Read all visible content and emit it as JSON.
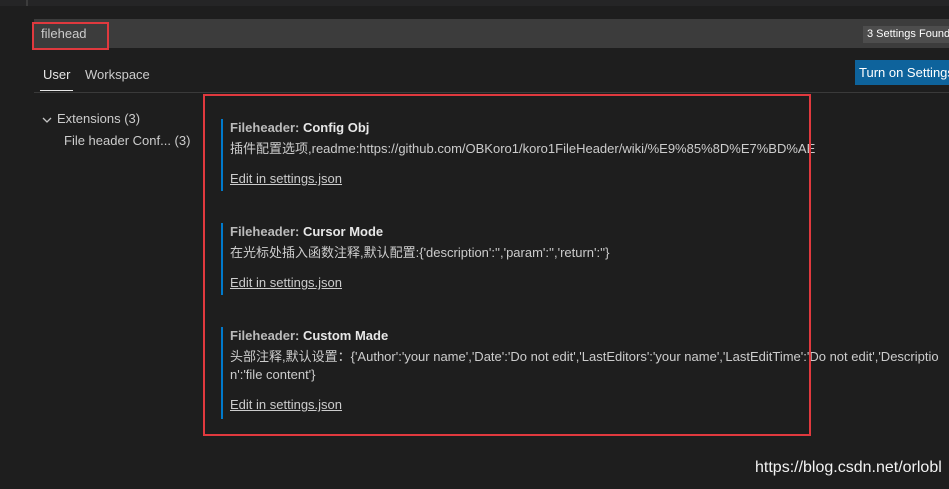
{
  "search": {
    "value": "filehead",
    "results_badge": "3 Settings Found"
  },
  "tabs": {
    "user": "User",
    "workspace": "Workspace"
  },
  "sync_button": "Turn on Settings Sync",
  "toc": {
    "extensions_label": "Extensions (3)",
    "child_label": "File header Conf... (3)"
  },
  "settings": [
    {
      "category": "Fileheader: ",
      "key": "Config Obj",
      "description": "插件配置选项,readme:https://github.com/OBKoro1/koro1FileHeader/wiki/%E9%85%8D%E7%BD%AE",
      "link": "Edit in settings.json"
    },
    {
      "category": "Fileheader: ",
      "key": "Cursor Mode",
      "description": "在光标处插入函数注释,默认配置:{'description':'','param':'','return':''}",
      "link": "Edit in settings.json"
    },
    {
      "category": "Fileheader: ",
      "key": "Custom Made",
      "description": "头部注释,默认设置：{'Author':'your name','Date':'Do not edit','LastEditors':'your name','LastEditTime':'Do not edit','Description':'file content'}",
      "link": "Edit in settings.json"
    }
  ],
  "watermark": "https://blog.csdn.net/orlobl",
  "colors": {
    "background": "#1e1e1e",
    "accent_border": "#007acc",
    "highlight_red": "#e0393e",
    "button_blue": "#0e639c"
  }
}
